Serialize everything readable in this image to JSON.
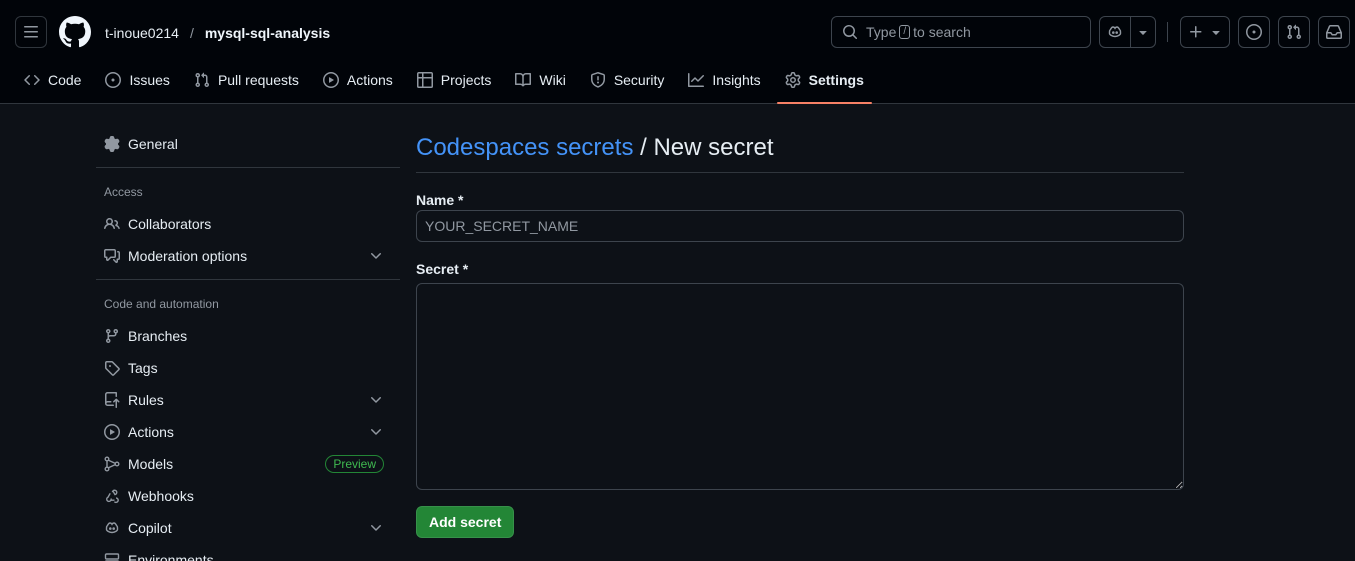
{
  "header": {
    "owner": "t-inoue0214",
    "separator": "/",
    "repo": "mysql-sql-analysis",
    "search_before": "Type",
    "search_key": "/",
    "search_after": "to search"
  },
  "tabs": [
    {
      "label": "Code",
      "icon": "code-icon"
    },
    {
      "label": "Issues",
      "icon": "issue-opened-icon"
    },
    {
      "label": "Pull requests",
      "icon": "git-pull-request-icon"
    },
    {
      "label": "Actions",
      "icon": "play-icon"
    },
    {
      "label": "Projects",
      "icon": "table-icon"
    },
    {
      "label": "Wiki",
      "icon": "book-icon"
    },
    {
      "label": "Security",
      "icon": "shield-icon"
    },
    {
      "label": "Insights",
      "icon": "graph-icon"
    },
    {
      "label": "Settings",
      "icon": "gear-icon",
      "active": true
    }
  ],
  "sidebar": {
    "general": "General",
    "access_heading": "Access",
    "collaborators": "Collaborators",
    "moderation": "Moderation options",
    "code_heading": "Code and automation",
    "branches": "Branches",
    "tags": "Tags",
    "rules": "Rules",
    "actions": "Actions",
    "models": "Models",
    "models_badge": "Preview",
    "webhooks": "Webhooks",
    "copilot": "Copilot",
    "environments": "Environments"
  },
  "main": {
    "title_link": "Codespaces secrets",
    "title_rest": " / New secret",
    "name_label": "Name *",
    "name_placeholder": "YOUR_SECRET_NAME",
    "name_value": "",
    "secret_label": "Secret *",
    "secret_value": "",
    "add_button": "Add secret"
  },
  "colors": {
    "accent_link": "#4493f8",
    "active_tab_underline": "#f78166",
    "primary_button": "#238636",
    "badge_green": "#3fb950"
  }
}
